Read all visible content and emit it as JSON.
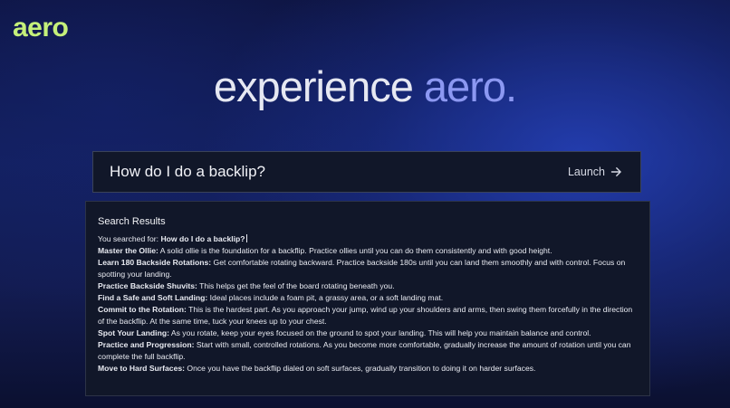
{
  "brand": {
    "logo_text": "aero"
  },
  "hero": {
    "main": "experience ",
    "accent": "aero."
  },
  "search": {
    "value": "How do I do a backlip?",
    "launch_label": "Launch"
  },
  "results": {
    "title": "Search Results",
    "searched_prefix": "You searched for: ",
    "searched_query": "How do I do a backlip?",
    "steps": [
      {
        "title": "Master the Ollie:",
        "text": " A solid ollie is the foundation for a backflip. Practice ollies until you can do them consistently and with good height."
      },
      {
        "title": "Learn 180 Backside Rotations:",
        "text": " Get comfortable rotating backward. Practice backside 180s until you can land them smoothly and with control. Focus on spotting your landing."
      },
      {
        "title": "Practice Backside Shuvits:",
        "text": " This helps get the feel of the board rotating beneath you."
      },
      {
        "title": "Find a Safe and Soft Landing:",
        "text": " Ideal places include a foam pit, a grassy area, or a soft landing mat."
      },
      {
        "title": "Commit to the Rotation:",
        "text": " This is the hardest part. As you approach your jump, wind up your shoulders and arms, then swing them forcefully in the direction of the backflip. At the same time, tuck your knees up to your chest."
      },
      {
        "title": "Spot Your Landing:",
        "text": " As you rotate, keep your eyes focused on the ground to spot your landing. This will help you maintain balance and control."
      },
      {
        "title": "Practice and Progression:",
        "text": " Start with small, controlled rotations. As you become more comfortable, gradually increase the amount of rotation until you can complete the full backflip."
      },
      {
        "title": "Move to Hard Surfaces:",
        "text": " Once you have the backflip dialed on soft surfaces, gradually transition to doing it on harder surfaces."
      }
    ]
  },
  "colors": {
    "logo": "#c5f07a",
    "accent": "#8c98f2",
    "panel": "#111729"
  },
  "icons": {
    "launch": "arrow-right-icon"
  }
}
